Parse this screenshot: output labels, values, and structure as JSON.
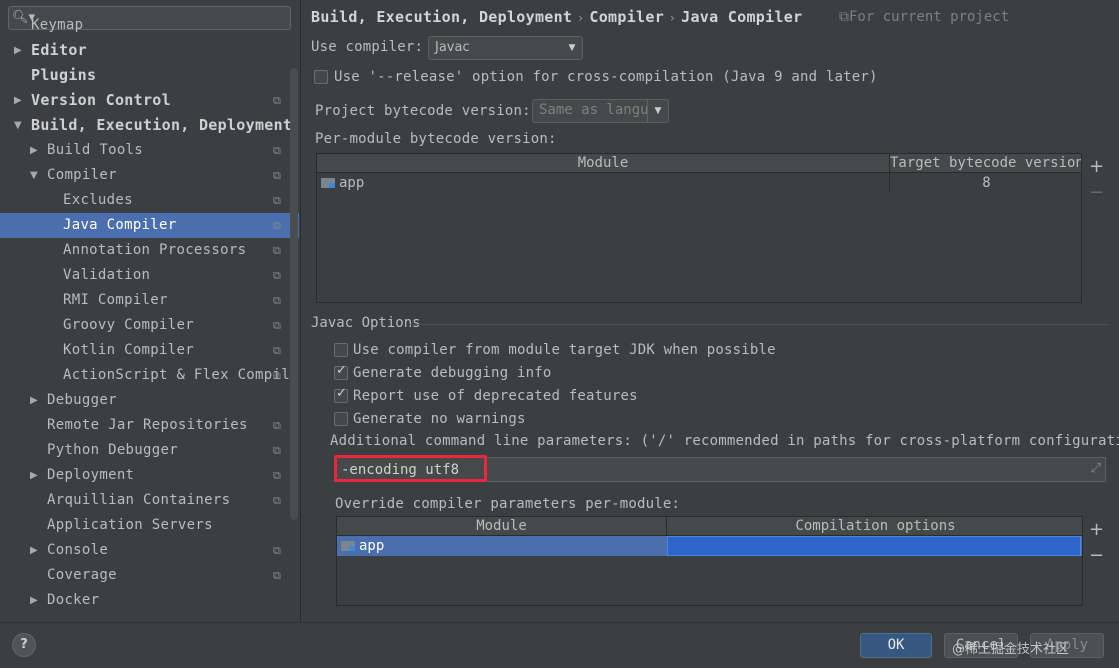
{
  "sidebar": {
    "search": {
      "placeholder": "",
      "value": ""
    },
    "items": [
      {
        "label": "Keymap",
        "level": 0,
        "arrow": "",
        "bold": false,
        "proj": false,
        "selected": false
      },
      {
        "label": "Editor",
        "level": 0,
        "arrow": "▶",
        "bold": true,
        "proj": false,
        "selected": false
      },
      {
        "label": "Plugins",
        "level": 0,
        "arrow": "",
        "bold": true,
        "proj": false,
        "selected": false
      },
      {
        "label": "Version Control",
        "level": 0,
        "arrow": "▶",
        "bold": true,
        "proj": true,
        "selected": false
      },
      {
        "label": "Build, Execution, Deployment",
        "level": 0,
        "arrow": "▼",
        "bold": true,
        "proj": false,
        "selected": false
      },
      {
        "label": "Build Tools",
        "level": 1,
        "arrow": "▶",
        "bold": false,
        "proj": true,
        "selected": false
      },
      {
        "label": "Compiler",
        "level": 1,
        "arrow": "▼",
        "bold": false,
        "proj": true,
        "selected": false
      },
      {
        "label": "Excludes",
        "level": 2,
        "arrow": "",
        "bold": false,
        "proj": true,
        "selected": false
      },
      {
        "label": "Java Compiler",
        "level": 2,
        "arrow": "",
        "bold": false,
        "proj": true,
        "selected": true
      },
      {
        "label": "Annotation Processors",
        "level": 2,
        "arrow": "",
        "bold": false,
        "proj": true,
        "selected": false
      },
      {
        "label": "Validation",
        "level": 2,
        "arrow": "",
        "bold": false,
        "proj": true,
        "selected": false
      },
      {
        "label": "RMI Compiler",
        "level": 2,
        "arrow": "",
        "bold": false,
        "proj": true,
        "selected": false
      },
      {
        "label": "Groovy Compiler",
        "level": 2,
        "arrow": "",
        "bold": false,
        "proj": true,
        "selected": false
      },
      {
        "label": "Kotlin Compiler",
        "level": 2,
        "arrow": "",
        "bold": false,
        "proj": true,
        "selected": false
      },
      {
        "label": "ActionScript & Flex Compil",
        "level": 2,
        "arrow": "",
        "bold": false,
        "proj": true,
        "selected": false
      },
      {
        "label": "Debugger",
        "level": 1,
        "arrow": "▶",
        "bold": false,
        "proj": false,
        "selected": false
      },
      {
        "label": "Remote Jar Repositories",
        "level": 1,
        "arrow": "",
        "bold": false,
        "proj": true,
        "selected": false
      },
      {
        "label": "Python Debugger",
        "level": 1,
        "arrow": "",
        "bold": false,
        "proj": true,
        "selected": false
      },
      {
        "label": "Deployment",
        "level": 1,
        "arrow": "▶",
        "bold": false,
        "proj": true,
        "selected": false
      },
      {
        "label": "Arquillian Containers",
        "level": 1,
        "arrow": "",
        "bold": false,
        "proj": true,
        "selected": false
      },
      {
        "label": "Application Servers",
        "level": 1,
        "arrow": "",
        "bold": false,
        "proj": false,
        "selected": false
      },
      {
        "label": "Console",
        "level": 1,
        "arrow": "▶",
        "bold": false,
        "proj": true,
        "selected": false
      },
      {
        "label": "Coverage",
        "level": 1,
        "arrow": "",
        "bold": false,
        "proj": true,
        "selected": false
      },
      {
        "label": "Docker",
        "level": 1,
        "arrow": "▶",
        "bold": false,
        "proj": false,
        "selected": false
      }
    ]
  },
  "header": {
    "crumb1": "Build, Execution, Deployment",
    "crumb2": "Compiler",
    "crumb3": "Java Compiler",
    "separator": "›",
    "scope": "⧉For current project"
  },
  "compiler": {
    "use_compiler_label": "Use compiler:",
    "use_compiler_value": "Javac",
    "release_option_label": "Use '--release' option for cross-compilation (Java 9 and later)",
    "release_option_checked": false,
    "project_bytecode_label": "Project bytecode version:",
    "project_bytecode_value": "Same as langu",
    "per_module_label": "Per-module bytecode version:"
  },
  "bytecode_table": {
    "col_module": "Module",
    "col_target": "Target bytecode version",
    "rows": [
      {
        "module": "app",
        "target": "8"
      }
    ],
    "add": "+",
    "remove": "−"
  },
  "javac": {
    "group_title": "Javac Options",
    "opt_module_jdk": "Use compiler from module target JDK when possible",
    "opt_module_jdk_checked": false,
    "opt_debug": "Generate debugging info",
    "opt_debug_checked": true,
    "opt_deprecated": "Report use of deprecated features",
    "opt_deprecated_checked": true,
    "opt_no_warnings": "Generate no warnings",
    "opt_no_warnings_checked": false,
    "params_label": "Additional command line parameters:  ('/' recommended in paths for cross-platform configurations)",
    "params_value": "-encoding utf8",
    "override_label": "Override compiler parameters per-module:"
  },
  "override_table": {
    "col_module": "Module",
    "col_options": "Compilation options",
    "rows": [
      {
        "module": "app",
        "options": ""
      }
    ],
    "add": "+",
    "remove": "−"
  },
  "footer": {
    "help": "?",
    "ok": "OK",
    "cancel": "Cancel",
    "apply": "Apply",
    "watermark": "@稀土掘金技术社区"
  }
}
